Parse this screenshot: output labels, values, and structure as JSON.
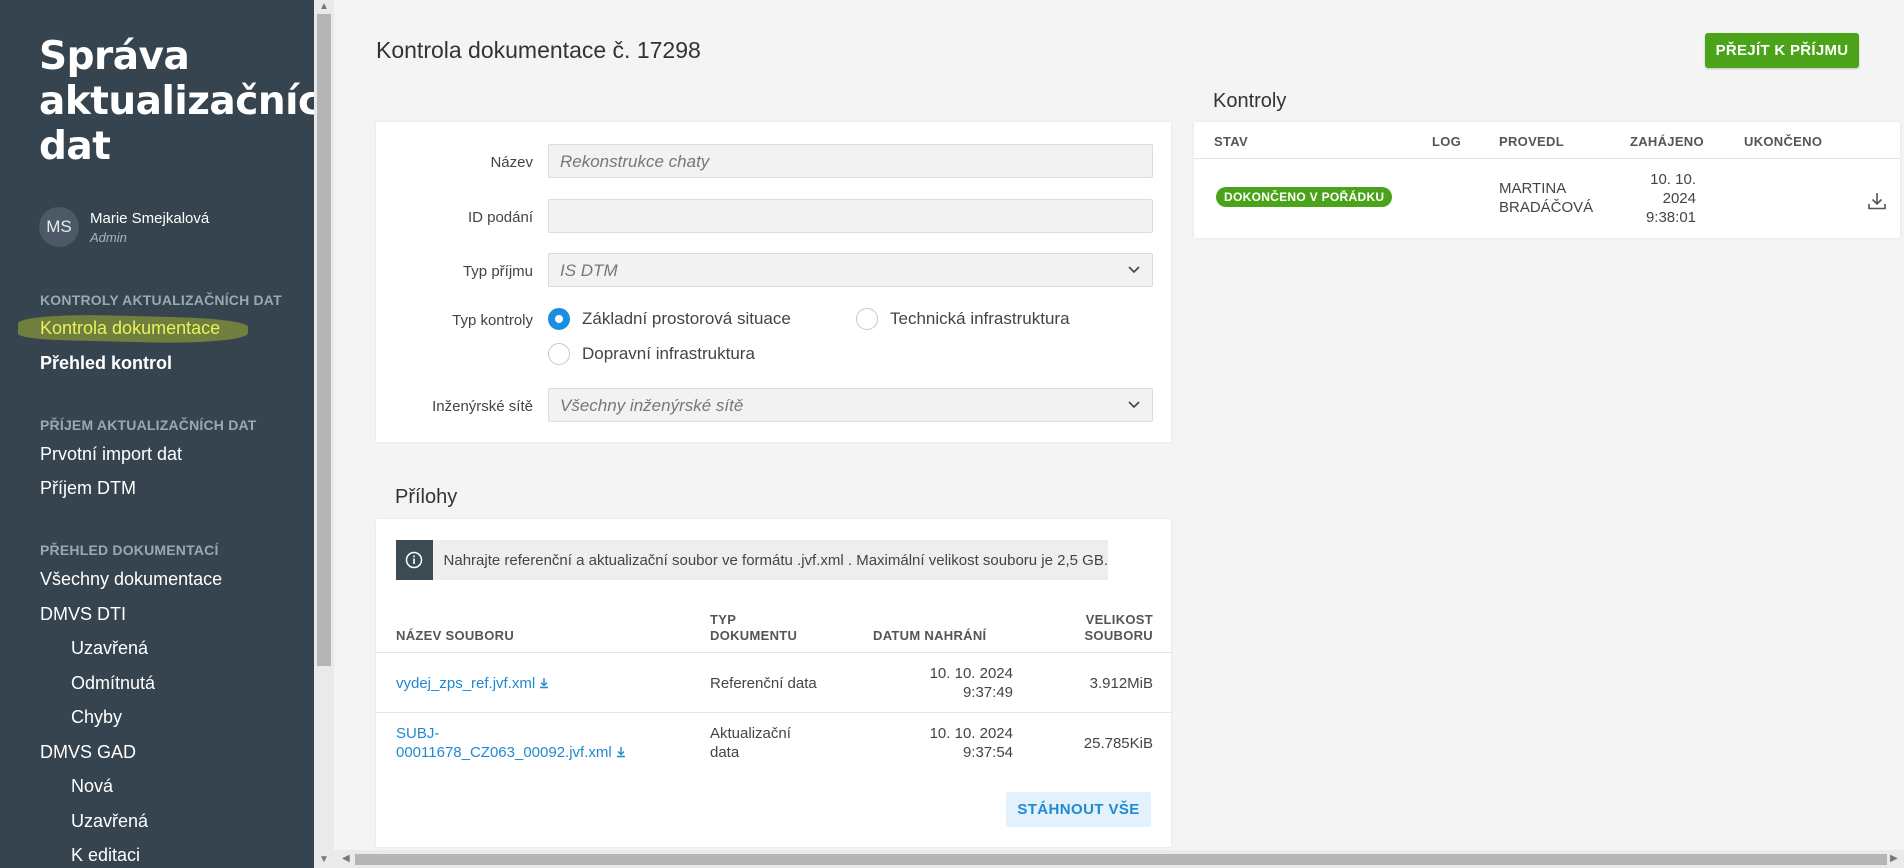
{
  "sidebar": {
    "app_title": "Správa aktualizačních dat",
    "user": {
      "initials": "MS",
      "name": "Marie Smejkalová",
      "role": "Admin"
    },
    "sections": [
      {
        "title": "KONTROLY AKTUALIZAČNÍCH DAT"
      },
      {
        "title": "PŘÍJEM AKTUALIZAČNÍCH DAT"
      },
      {
        "title": "PŘEHLED DOKUMENTACÍ"
      }
    ],
    "items": [
      {
        "label": "Kontrola dokumentace"
      },
      {
        "label": "Přehled kontrol"
      },
      {
        "label": "Prvotní import dat"
      },
      {
        "label": "Příjem DTM"
      },
      {
        "label": "Všechny dokumentace"
      },
      {
        "label": "DMVS DTI"
      },
      {
        "label": "Uzavřená"
      },
      {
        "label": "Odmítnutá"
      },
      {
        "label": "Chyby"
      },
      {
        "label": "DMVS GAD"
      },
      {
        "label": "Nová"
      },
      {
        "label": "Uzavřená"
      },
      {
        "label": "K editaci"
      }
    ]
  },
  "header": {
    "title": "Kontrola dokumentace č. 17298",
    "primary_button": "PŘEJÍT K PŘÍJMU"
  },
  "form": {
    "fields": [
      {
        "label": "Název",
        "value": "Rekonstrukce chaty"
      },
      {
        "label": "ID podání",
        "value": ""
      },
      {
        "label": "Typ příjmu",
        "value": "IS DTM"
      },
      {
        "label": "Typ kontroly"
      },
      {
        "label": "Inženýrské sítě",
        "value": "Všechny inženýrské sítě"
      }
    ],
    "radios": [
      {
        "label": "Základní prostorová situace",
        "selected": true
      },
      {
        "label": "Technická infrastruktura",
        "selected": false
      },
      {
        "label": "Dopravní infrastruktura",
        "selected": false
      }
    ]
  },
  "attachments": {
    "title": "Přílohy",
    "info": "Nahrajte referenční a aktualizační soubor ve formátu .jvf.xml . Maximální velikost souboru je 2,5 GB.",
    "columns": [
      "NÁZEV SOUBORU",
      "TYP\nDOKUMENTU",
      "DATUM NAHRÁNÍ",
      "VELIKOST\nSOUBORU"
    ],
    "rows": [
      {
        "name": "vydej_zps_ref.jvf.xml",
        "type": "Referenční data",
        "date": "10. 10. 2024\n9:37:49",
        "size": "3.912MiB"
      },
      {
        "name": "SUBJ-\n00011678_CZ063_00092.jvf.xml",
        "type": "Aktualizační\ndata",
        "date": "10. 10. 2024\n9:37:54",
        "size": "25.785KiB"
      }
    ],
    "download_all": "STÁHNOUT VŠE"
  },
  "kontroly": {
    "title": "Kontroly",
    "columns": [
      "STAV",
      "LOG",
      "PROVEDL",
      "ZAHÁJENO",
      "UKONČENO"
    ],
    "rows": [
      {
        "status": "DOKONČENO V POŘÁDKU",
        "log": "",
        "by": "MARTINA\nBRADÁČOVÁ",
        "started": "10. 10.\n2024\n9:38:01",
        "ended": ""
      }
    ]
  },
  "colors": {
    "sidebar": "#35444f",
    "primary": "#4ba31a",
    "link": "#1f8ad0",
    "highlight": "#e8f35a"
  }
}
